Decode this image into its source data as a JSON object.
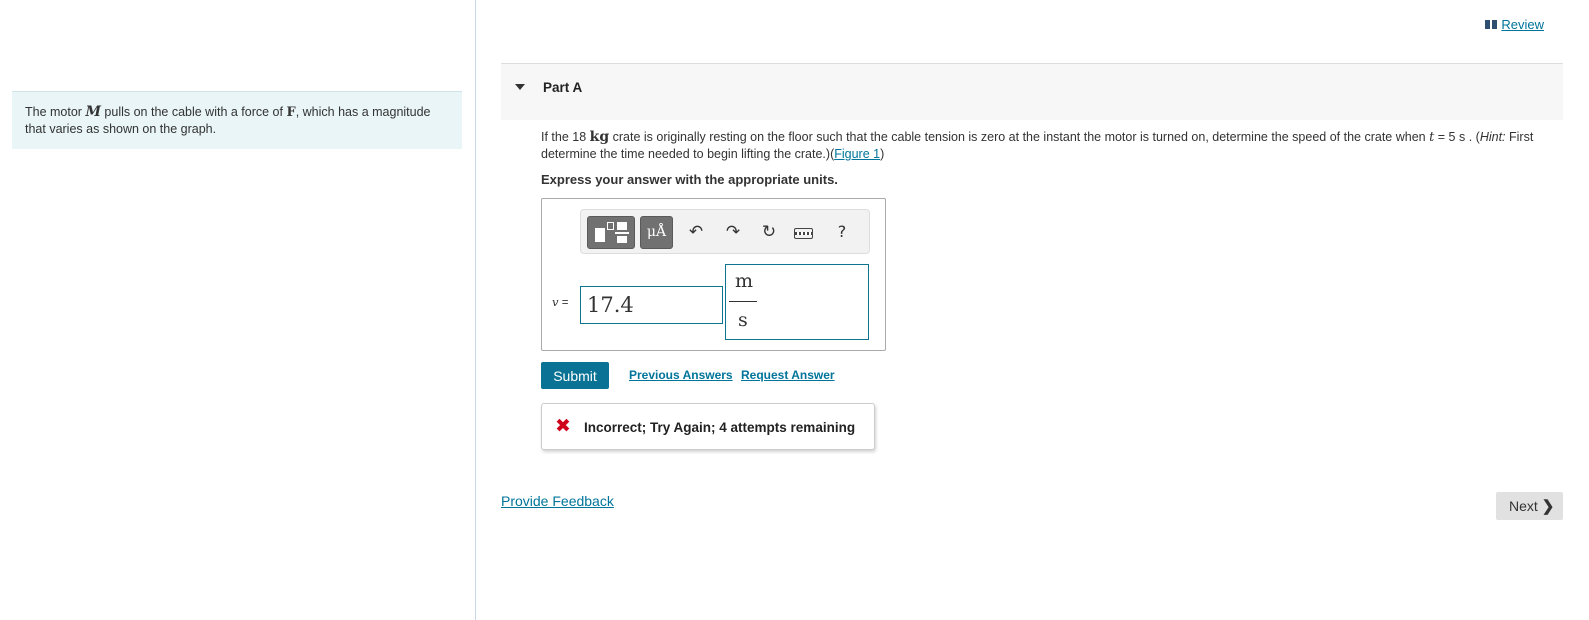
{
  "intro": {
    "text_before_m": "The motor ",
    "m_symbol": "M",
    "text_mid": " pulls on the cable with a force of ",
    "f_symbol": "F",
    "text_after": ", which has a magnitude that varies as shown on the graph."
  },
  "header": {
    "review_label": "Review",
    "review_icon": "book-icon"
  },
  "part": {
    "title": "Part A"
  },
  "question": {
    "pre_mass": "If the 18 ",
    "mass_unit": "kg",
    "mid_text": " crate is originally resting on the floor such that the cable tension is zero at the instant the motor is turned on, determine the speed of the crate when ",
    "t_symbol": "t",
    "t_value": " = 5 s . (",
    "hint_label": "Hint:",
    "hint_text": " First determine the time needed to begin lifting the crate.)(",
    "figure_link": "Figure 1",
    "close_paren": ")",
    "instruction": "Express your answer with the appropriate units."
  },
  "answer": {
    "variable_symbol": "v",
    "equals": " =",
    "value": "17.4",
    "unit_numerator": "m",
    "unit_denominator": "s"
  },
  "toolbar": {
    "units_label": "μÅ",
    "undo_icon": "↶",
    "redo_icon": "↷",
    "reset_icon": "↻",
    "help_label": "?"
  },
  "actions": {
    "submit_label": "Submit",
    "previous_answers": "Previous Answers",
    "request_answer": "Request Answer"
  },
  "feedback": {
    "icon": "✖",
    "message": "Incorrect; Try Again; 4 attempts remaining"
  },
  "footer": {
    "provide_feedback": "Provide Feedback",
    "next_label": "Next",
    "next_icon": "❯"
  }
}
